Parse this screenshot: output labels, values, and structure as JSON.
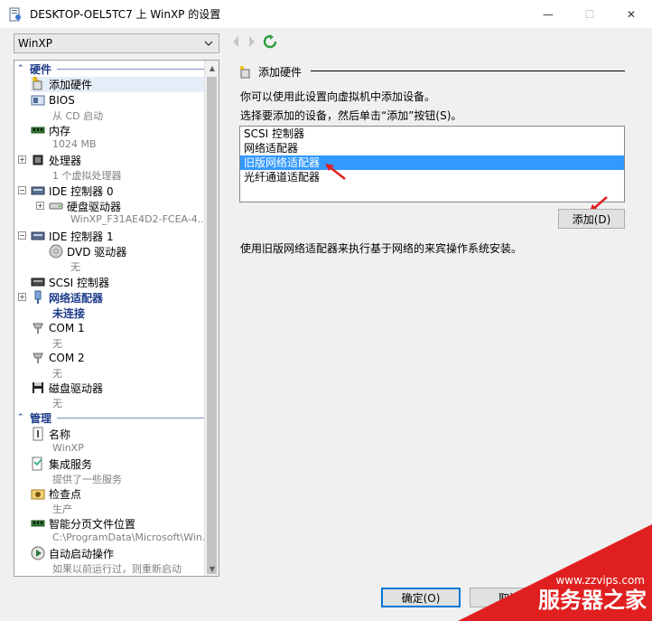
{
  "window": {
    "title": "DESKTOP-OEL5TC7 上 WinXP 的设置",
    "minimize": "—",
    "maximize": "☐",
    "close": "✕"
  },
  "vm_selector": {
    "value": "WinXP"
  },
  "sidebar": {
    "hardware_header": "硬件",
    "management_header": "管理",
    "hardware_items": [
      {
        "label": "添加硬件",
        "icon": "add-hardware-icon"
      },
      {
        "label": "BIOS",
        "sub": "从 CD 启动",
        "icon": "bios-icon"
      },
      {
        "label": "内存",
        "sub": "1024 MB",
        "icon": "memory-icon"
      },
      {
        "label": "处理器",
        "sub": "1 个虚拟处理器",
        "icon": "processor-icon"
      },
      {
        "label": "IDE 控制器 0",
        "icon": "ide-controller-icon"
      },
      {
        "label": "硬盘驱动器",
        "sub": "WinXP_F31AE4D2-FCEA-4...",
        "icon": "hard-drive-icon"
      },
      {
        "label": "IDE 控制器 1",
        "icon": "ide-controller-icon"
      },
      {
        "label": "DVD 驱动器",
        "sub": "无",
        "icon": "dvd-drive-icon"
      },
      {
        "label": "SCSI 控制器",
        "icon": "scsi-controller-icon"
      },
      {
        "label": "网络适配器",
        "sub": "未连接",
        "icon": "network-adapter-icon"
      },
      {
        "label": "COM 1",
        "sub": "无",
        "icon": "com-port-icon"
      },
      {
        "label": "COM 2",
        "sub": "无",
        "icon": "com-port-icon"
      },
      {
        "label": "磁盘驱动器",
        "sub": "无",
        "icon": "floppy-drive-icon"
      }
    ],
    "management_items": [
      {
        "label": "名称",
        "sub": "WinXP",
        "icon": "name-icon"
      },
      {
        "label": "集成服务",
        "sub": "提供了一些服务",
        "icon": "integration-services-icon"
      },
      {
        "label": "检查点",
        "sub": "生产",
        "icon": "checkpoint-icon"
      },
      {
        "label": "智能分页文件位置",
        "sub": "C:\\ProgramData\\Microsoft\\Win...",
        "icon": "paging-file-icon"
      },
      {
        "label": "自动启动操作",
        "sub": "如果以前运行过，则重新启动",
        "icon": "auto-start-icon"
      }
    ]
  },
  "panel": {
    "heading": "添加硬件",
    "line1": "你可以使用此设置向虚拟机中添加设备。",
    "line2": "选择要添加的设备，然后单击“添加”按钮(S)。",
    "devices": [
      "SCSI 控制器",
      "网络适配器",
      "旧版网络适配器",
      "光纤通道适配器"
    ],
    "selected_device": "旧版网络适配器",
    "add_button": "添加(D)",
    "description": "使用旧版网络适配器来执行基于网络的来宾操作系统安装。"
  },
  "footer": {
    "ok_button": "确定(O)",
    "cancel_button": "取消"
  },
  "watermark": {
    "url": "www.zzvips.com",
    "brand": "服务器之家"
  },
  "colors": {
    "accent": "#3399ff",
    "section_blue": "#1e3c8a",
    "watermark_red": "#e02020",
    "arrow_red": "#e02020"
  }
}
